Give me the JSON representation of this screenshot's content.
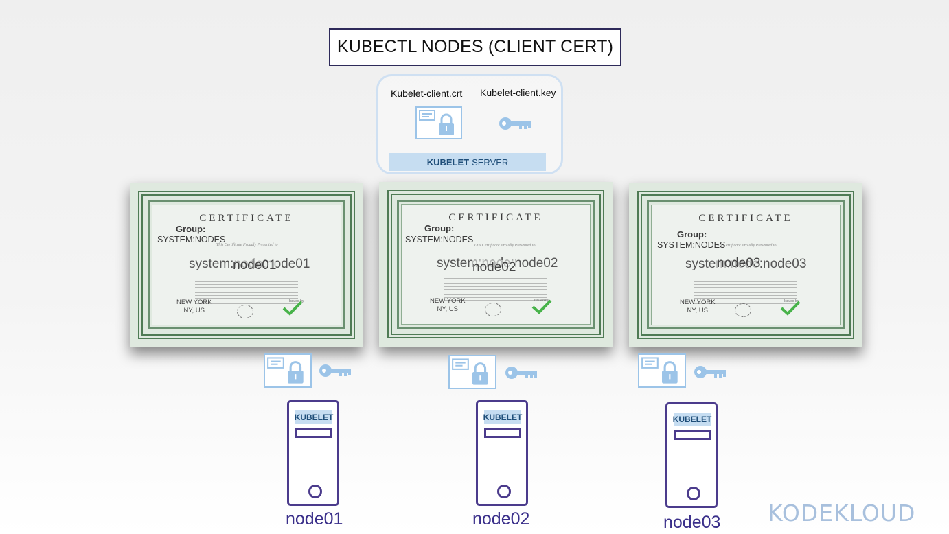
{
  "title": "KUBECTL NODES (CLIENT CERT)",
  "server": {
    "crt_label": "Kubelet-client.crt",
    "key_label": "Kubelet-client.key",
    "band_bold": "KUBELET",
    "band_rest": "SERVER"
  },
  "certificates": [
    {
      "heading": "CERTIFICATE",
      "group_label": "Group:",
      "group_value": "SYSTEM:NODES",
      "presented": "This Certificate Proudly Presented to",
      "cn": "system:node:node01",
      "overlay": "node01",
      "city": "NEW YORK",
      "region": "NY, US",
      "issued": "Issued by"
    },
    {
      "heading": "CERTIFICATE",
      "group_label": "Group:",
      "group_value": "SYSTEM:NODES",
      "presented": "This Certificate Proudly Presented to",
      "cn": "system:node:node02",
      "overlay": "node02",
      "city": "NEW YORK",
      "region": "NY, US",
      "issued": "Issued by"
    },
    {
      "heading": "CERTIFICATE",
      "group_label": "Group:",
      "group_value": "SYSTEM:NODES",
      "presented": "This Certificate Proudly Presented to",
      "cn": "system:node:node03",
      "overlay": "node03",
      "city": "NEW YORK",
      "region": "NY, US",
      "issued": "Issued by"
    }
  ],
  "nodes": [
    {
      "tag": "KUBELET",
      "label": "node01"
    },
    {
      "tag": "KUBELET",
      "label": "node02"
    },
    {
      "tag": "KUBELET",
      "label": "node03"
    }
  ],
  "colors": {
    "accent": "#4b3b8c",
    "light_blue": "#9cc4e8",
    "band": "#c6ddf1",
    "cert_green": "#4f7b55"
  },
  "icons": [
    "certificate-icon",
    "lock-icon",
    "key-icon",
    "server-icon",
    "check-icon"
  ],
  "logo": "KODEKLOUD"
}
